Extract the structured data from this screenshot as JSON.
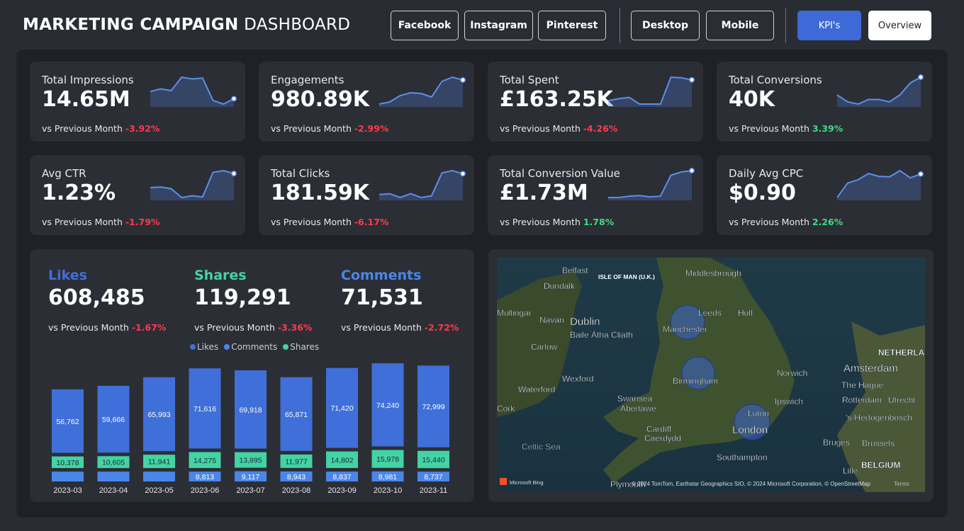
{
  "header": {
    "title_bold": "MARKETING CAMPAIGN",
    "title_light": "DASHBOARD",
    "platform_buttons": [
      "Facebook",
      "Instagram",
      "Pinterest"
    ],
    "device_buttons": [
      "Desktop",
      "Mobile"
    ],
    "view_buttons": [
      "KPI's",
      "Overview"
    ],
    "active_view": "KPI's"
  },
  "colors": {
    "accent": "#3d6ad6",
    "likes": "#3f6fd8",
    "comments": "#4a86e8",
    "shares": "#43d3a5",
    "negative": "#ff3b4a",
    "positive": "#3ddc84"
  },
  "kpis": [
    {
      "label": "Total Impressions",
      "value": "14.65M",
      "compare_label": "vs Previous Month",
      "delta": "-3.92%",
      "trend": "negative"
    },
    {
      "label": "Engagements",
      "value": "980.89K",
      "compare_label": "vs Previous Month",
      "delta": "-2.99%",
      "trend": "negative"
    },
    {
      "label": "Total Spent",
      "value": "£163.25K",
      "compare_label": "vs Previous Month",
      "delta": "-4.26%",
      "trend": "negative"
    },
    {
      "label": "Total Conversions",
      "value": "40K",
      "compare_label": "vs Previous Month",
      "delta": "3.39%",
      "trend": "positive"
    },
    {
      "label": "Avg CTR",
      "value": "1.23%",
      "compare_label": "vs Previous Month",
      "delta": "-1.79%",
      "trend": "negative"
    },
    {
      "label": "Total Clicks",
      "value": "181.59K",
      "compare_label": "vs Previous Month",
      "delta": "-6.17%",
      "trend": "negative"
    },
    {
      "label": "Total Conversion Value",
      "value": "£1.73M",
      "compare_label": "vs Previous Month",
      "delta": "1.78%",
      "trend": "positive"
    },
    {
      "label": "Daily Avg CPC",
      "value": "$0.90",
      "compare_label": "vs Previous Month",
      "delta": "2.26%",
      "trend": "positive"
    }
  ],
  "engagement": {
    "likes": {
      "label": "Likes",
      "value": "608,485",
      "compare_label": "vs Previous Month",
      "delta": "-1.67%"
    },
    "shares": {
      "label": "Shares",
      "value": "119,291",
      "compare_label": "vs Previous Month",
      "delta": "-3.36%"
    },
    "comments": {
      "label": "Comments",
      "value": "71,531",
      "compare_label": "vs Previous Month",
      "delta": "-2.72%"
    }
  },
  "chart_data": [
    {
      "type": "bar",
      "stacked": true,
      "legend": [
        "Likes",
        "Comments",
        "Shares"
      ],
      "legend_position": "top-center",
      "categories": [
        "2023-03",
        "2023-04",
        "2023-05",
        "2023-06",
        "2023-07",
        "2023-08",
        "2023-09",
        "2023-10",
        "2023-11"
      ],
      "series": [
        {
          "name": "Comments",
          "values": [
            null,
            null,
            null,
            8813,
            9117,
            8943,
            8837,
            8981,
            8737
          ]
        },
        {
          "name": "Shares",
          "values": [
            10378,
            10605,
            11941,
            14275,
            13895,
            11977,
            14802,
            15978,
            15440
          ]
        },
        {
          "name": "Likes",
          "values": [
            56762,
            59666,
            65993,
            71616,
            69918,
            65871,
            71420,
            74240,
            72999
          ]
        }
      ],
      "grid": false
    },
    {
      "type": "line",
      "note_series": "Total Impressions",
      "values": [
        6.2,
        6.5,
        6.3,
        7.8,
        7.6,
        7.7,
        5.2,
        4.8,
        5.4
      ],
      "marker_last": true
    },
    {
      "type": "line",
      "note_series": "Engagements",
      "values": [
        5.0,
        5.3,
        6.2,
        6.6,
        6.5,
        6.0,
        8.2,
        8.8,
        8.4
      ]
    },
    {
      "type": "line",
      "note_series": "Total Spent",
      "values": [
        5.5,
        5.8,
        6.0,
        5.0,
        5.0,
        5.0,
        9.0,
        8.9,
        8.6
      ]
    },
    {
      "type": "line",
      "note_series": "Total Conversions",
      "values": [
        6.0,
        4.8,
        4.4,
        5.2,
        5.2,
        4.8,
        6.0,
        8.1,
        9.1
      ]
    },
    {
      "type": "line",
      "note_series": "Avg CTR",
      "values": [
        6.4,
        6.5,
        6.2,
        4.7,
        5.0,
        4.8,
        9.0,
        9.3,
        8.8
      ]
    },
    {
      "type": "line",
      "note_series": "Total Clicks",
      "values": [
        6.2,
        6.3,
        5.8,
        6.3,
        5.8,
        6.0,
        9.0,
        9.3,
        8.9
      ]
    },
    {
      "type": "line",
      "note_series": "Total Conversion Value",
      "values": [
        5.0,
        5.0,
        5.2,
        5.3,
        5.1,
        5.2,
        8.4,
        8.9,
        9.1
      ]
    },
    {
      "type": "line",
      "note_series": "Daily Avg CPC",
      "values": [
        3.5,
        6.5,
        7.2,
        8.5,
        7.9,
        7.8,
        9.1,
        7.6,
        8.4
      ]
    }
  ],
  "map": {
    "cities": [
      "Belfast",
      "Dundalk",
      "Middlesbrough",
      "Leeds",
      "Hull",
      "Manchester",
      "Dublin",
      "Baile Átha Cliath",
      "Navan",
      "Mullingar",
      "Carlow",
      "Wexford",
      "Waterford",
      "Cork",
      "Birmingham",
      "Norwich",
      "Luton",
      "Ipswich",
      "Swansea",
      "Abertawe",
      "Cardiff",
      "Caerdydd",
      "London",
      "Southampton",
      "Plymouth",
      "Amsterdam",
      "The Hague",
      "Rotterdam",
      "Utrecht",
      "'s-Hertogenbosch",
      "Bruges",
      "Brussels",
      "Lille",
      "BELGIUM",
      "NETHERLANDS",
      "Celtic Sea"
    ],
    "region_label": "ISLE OF MAN (U.K.)",
    "bubbles": [
      "Manchester",
      "Birmingham",
      "London"
    ],
    "attribution": "© 2024 TomTom, Earthstar Geographics SIO, © 2024 Microsoft Corporation, © OpenStreetMap",
    "terms": "Terms",
    "brand": "Microsoft Bing"
  }
}
